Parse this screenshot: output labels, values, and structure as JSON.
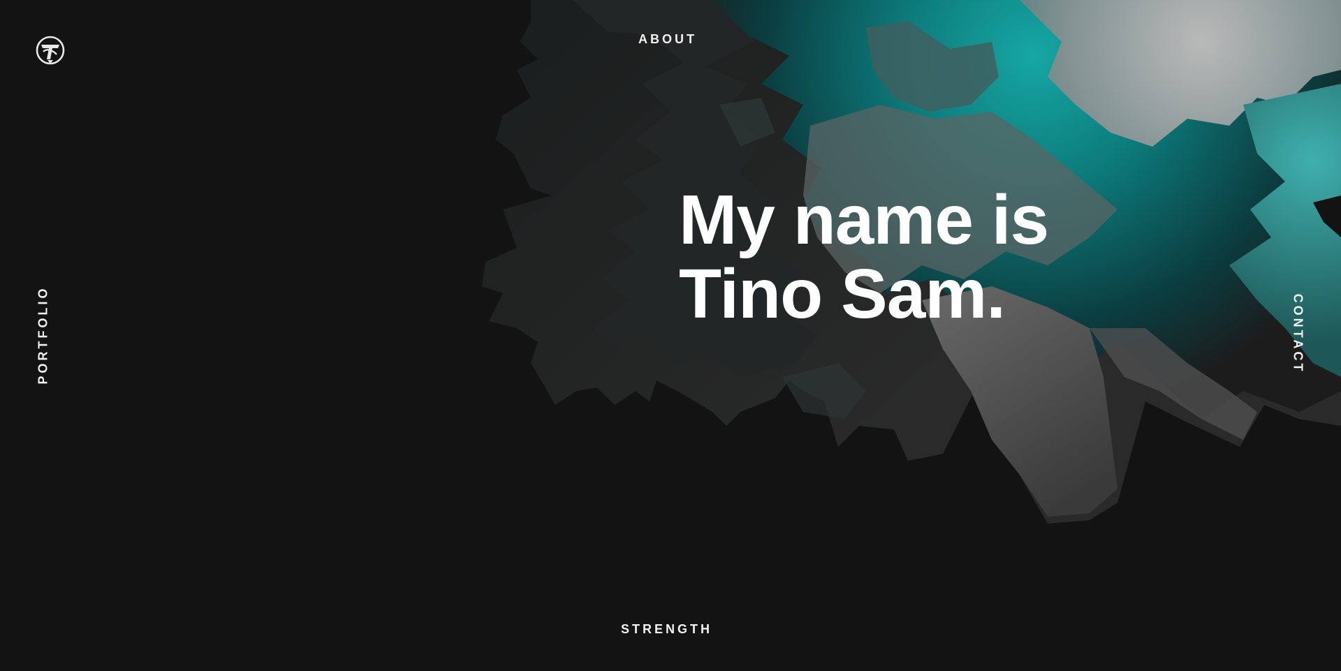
{
  "brand": {
    "logo_icon": "ts-monogram-logo-icon"
  },
  "nav": {
    "about": "ABOUT",
    "portfolio": "PORTFOLIO",
    "contact": "CONTACT",
    "strength": "STRENGTH"
  },
  "hero": {
    "line1": "My name is",
    "line2": "Tino Sam."
  },
  "colors": {
    "background": "#131313",
    "text": "#ffffff",
    "accent_teal": "#0e9c9c",
    "accent_grey": "#8a8a8a"
  }
}
